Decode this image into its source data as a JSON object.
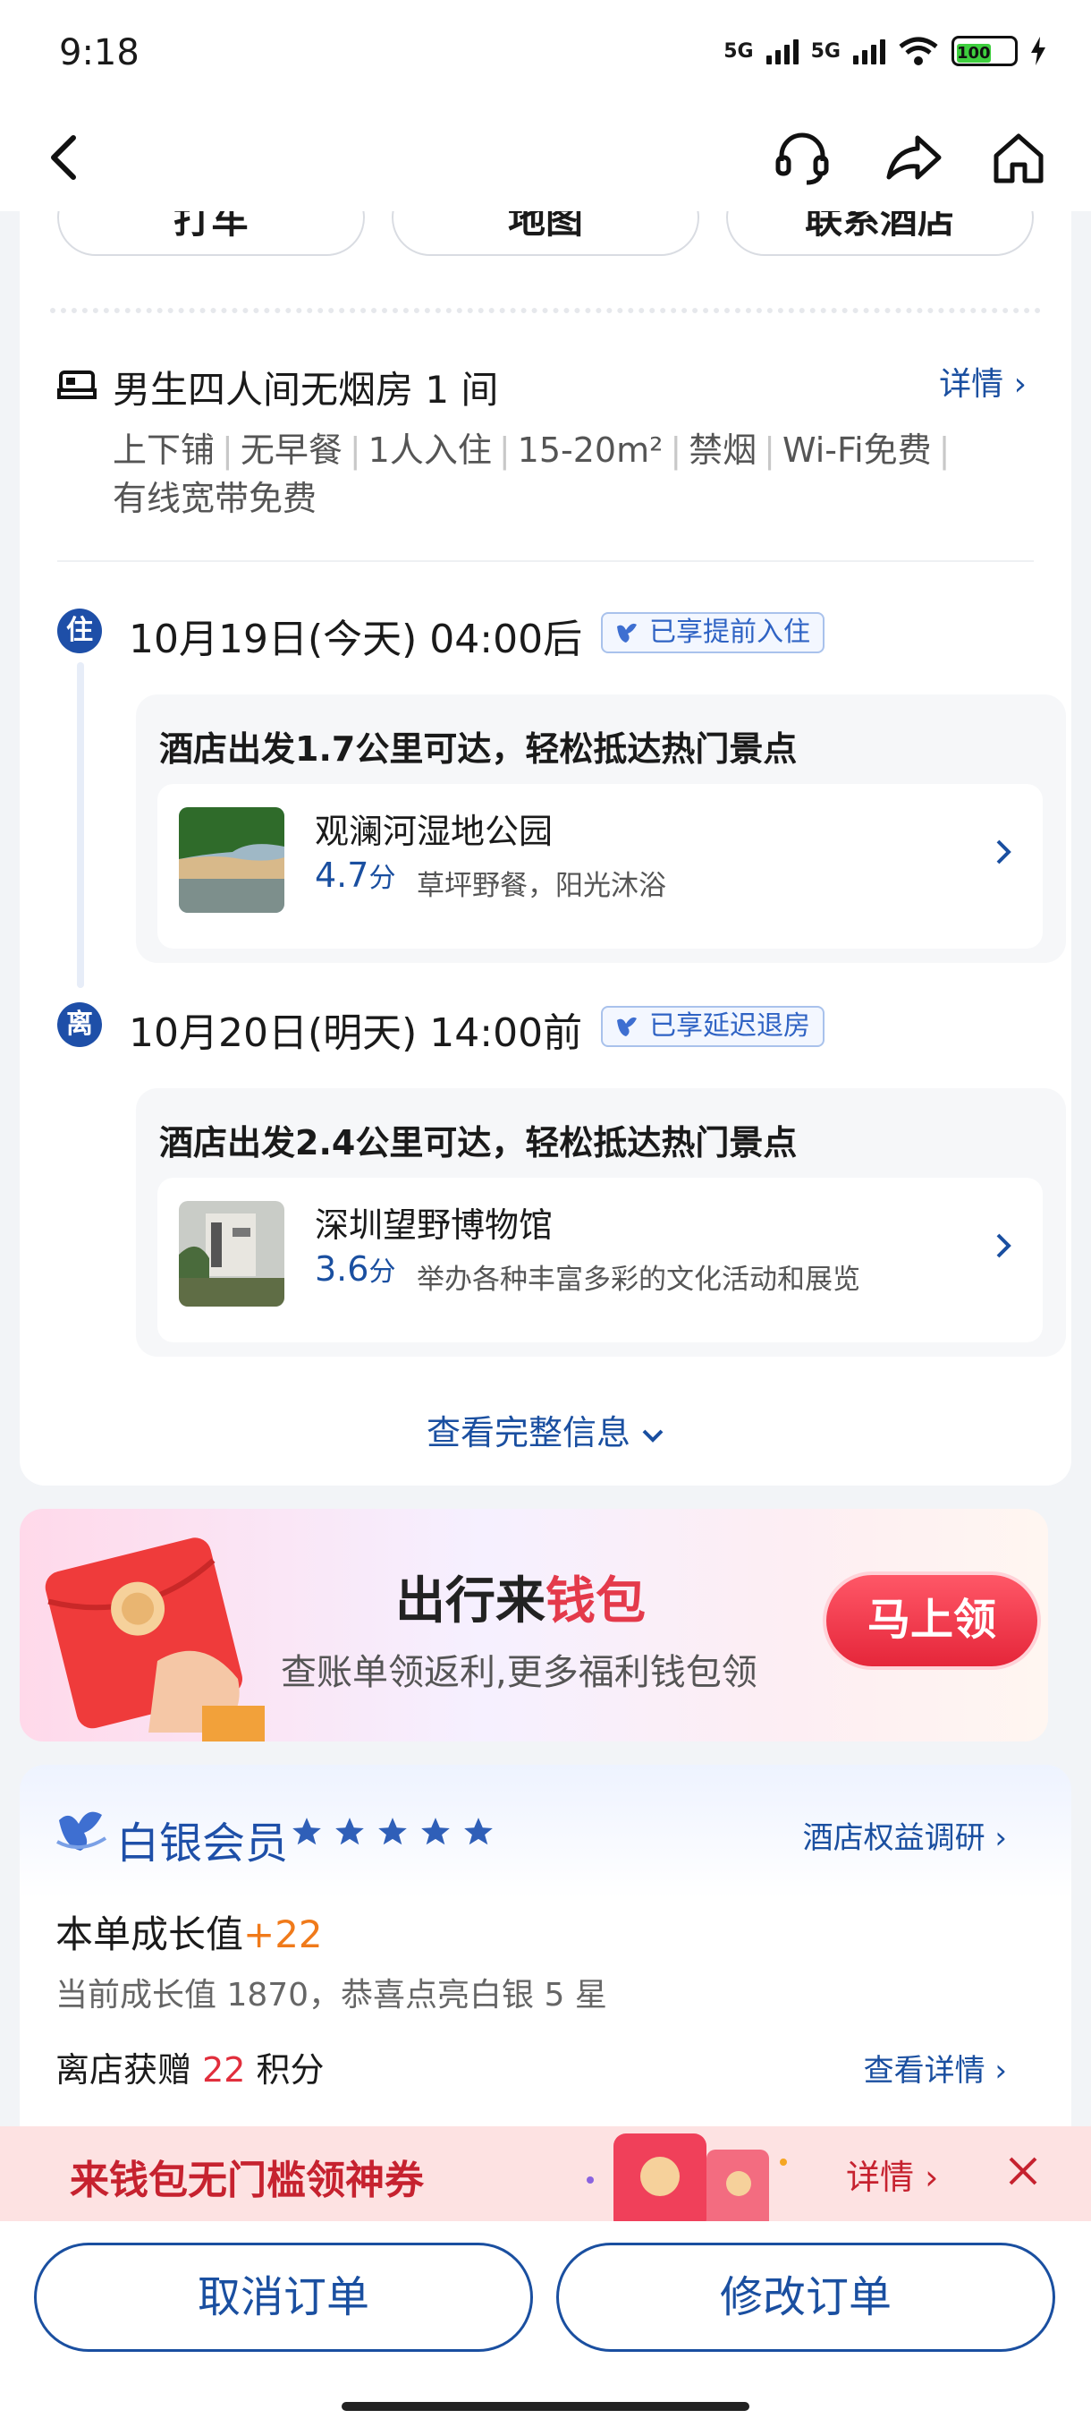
{
  "status_bar": {
    "time": "9:18",
    "network1": "5G",
    "network2": "5G",
    "wifi_label": "6",
    "battery": "100"
  },
  "nav": {
    "icons": [
      "back-icon",
      "customer-service-icon",
      "share-icon",
      "home-icon"
    ]
  },
  "action_buttons": [
    "打车",
    "地图",
    "联系酒店"
  ],
  "room": {
    "title": "男生四人间无烟房 1 间",
    "detail_label": "详情",
    "facilities": [
      "上下铺",
      "无早餐",
      "1人入住",
      "15-20m²",
      "禁烟",
      "Wi-Fi免费",
      "有线宽带免费"
    ]
  },
  "checkin": {
    "badge": "住",
    "date": "10月19日(今天) 04:00后",
    "tag": "已享提前入住",
    "nearby_title": "酒店出发1.7公里可达，轻松抵达热门景点",
    "spot_name": "观澜河湿地公园",
    "spot_score": "4.7",
    "score_unit": "分",
    "spot_desc": "草坪野餐，阳光沐浴"
  },
  "checkout": {
    "badge": "离",
    "date": "10月20日(明天) 14:00前",
    "tag": "已享延迟退房",
    "nearby_title": "酒店出发2.4公里可达，轻松抵达热门景点",
    "spot_name": "深圳望野博物馆",
    "spot_score": "3.6",
    "score_unit": "分",
    "spot_desc": "举办各种丰富多彩的文化活动和展览"
  },
  "view_all": "查看完整信息",
  "promo": {
    "title_part1": "出行来",
    "title_part2": "钱包",
    "subtitle": "查账单领返利,更多福利钱包领",
    "button": "马上领"
  },
  "member": {
    "level": "白银会员",
    "star_count": 5,
    "survey_link": "酒店权益调研",
    "growth_label": "本单成长值",
    "growth_value": "+22",
    "growth_sub": "当前成长值 1870，恭喜点亮白银 5 星",
    "points_prefix": "离店获赠 ",
    "points_value": "22",
    "points_suffix": " 积分",
    "points_link": "查看详情"
  },
  "coupon_strip": {
    "text": "来钱包无门槛领神券",
    "detail": "详情"
  },
  "bottom": {
    "cancel": "取消订单",
    "modify": "修改订单"
  },
  "colors": {
    "brand_blue": "#1a4fa0",
    "accent_red": "#e12e3c",
    "growth_orange": "#f07a1a"
  }
}
